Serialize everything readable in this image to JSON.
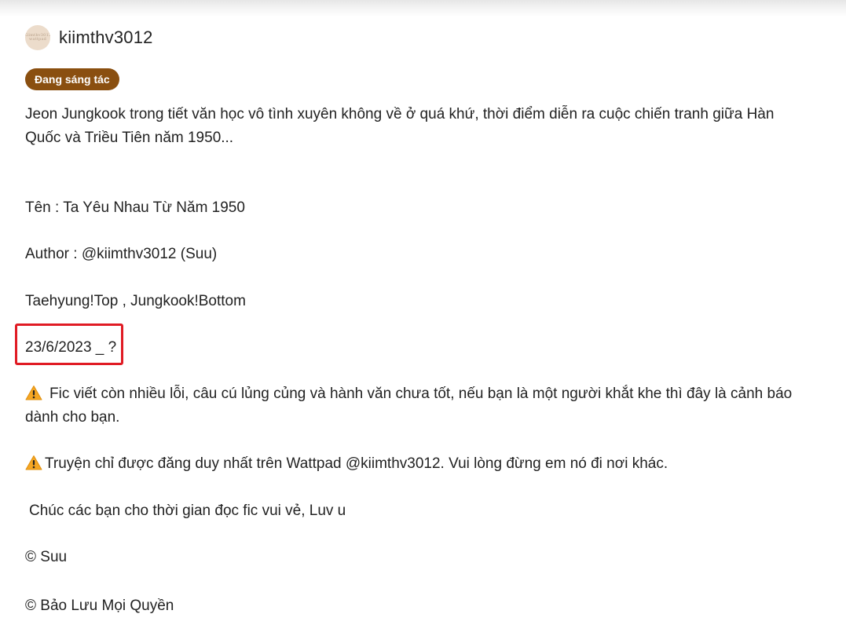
{
  "author": {
    "username": "kiimthv3012",
    "avatar_text": "Kiimthv3012 wattpad"
  },
  "status_badge": "Đang sáng tác",
  "description": {
    "intro": "Jeon Jungkook trong tiết văn học vô tình xuyên không về ở quá khứ, thời điểm diễn ra cuộc chiến tranh giữa Hàn Quốc và Triều Tiên năm 1950...",
    "title_line": "Tên : Ta Yêu Nhau Từ Năm 1950",
    "author_line": "Author : @kiimthv3012 (Suu)",
    "pairing_line": "Taehyung!Top , Jungkook!Bottom",
    "date_line": "23/6/2023 _ ?",
    "warning_1": "Fic viết còn nhiều lỗi, câu cú lủng củng và hành văn chưa tốt, nếu bạn là một người khắt khe thì đây là cảnh báo dành cho bạn.",
    "warning_2": "Truyện chỉ được đăng duy nhất trên Wattpad @kiimthv3012. Vui lòng đừng em nó đi nơi khác.",
    "greeting_line": "Chúc các bạn cho thời gian đọc fic vui vẻ, Luv u",
    "copyright_line": "© Suu",
    "rights_line": "© Bảo Lưu Mọi Quyền"
  },
  "icons": {
    "warning": "warning-icon",
    "warning_color": "#f5a623"
  },
  "colors": {
    "badge_bg": "#8a4f10",
    "highlight_border": "#e01b24"
  }
}
